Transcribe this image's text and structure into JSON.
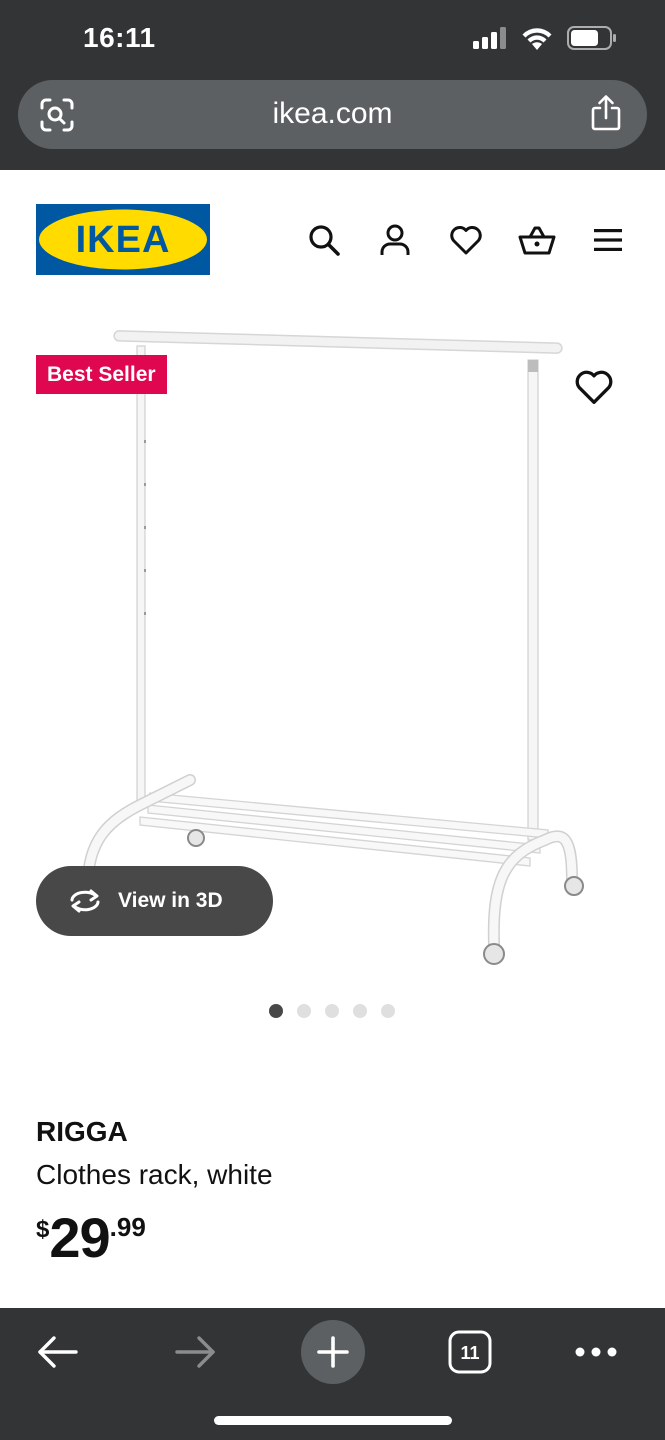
{
  "status_bar": {
    "time": "16:11"
  },
  "browser": {
    "url": "ikea.com",
    "tab_count": "11"
  },
  "ikea": {
    "logo_text": "IKEA",
    "brand_colors": {
      "blue": "#0058a3",
      "yellow": "#ffdb00"
    },
    "nav_icons": [
      "search-icon",
      "account-icon",
      "favorites-icon",
      "cart-icon",
      "menu-icon"
    ]
  },
  "product": {
    "badge": "Best Seller",
    "badge_color": "#e00751",
    "view_3d_label": "View in 3D",
    "image_count": 5,
    "active_image": 1,
    "name": "RIGGA",
    "description": "Clothes rack, white",
    "price": {
      "currency": "$",
      "integer": "29",
      "decimal": ".99"
    }
  }
}
